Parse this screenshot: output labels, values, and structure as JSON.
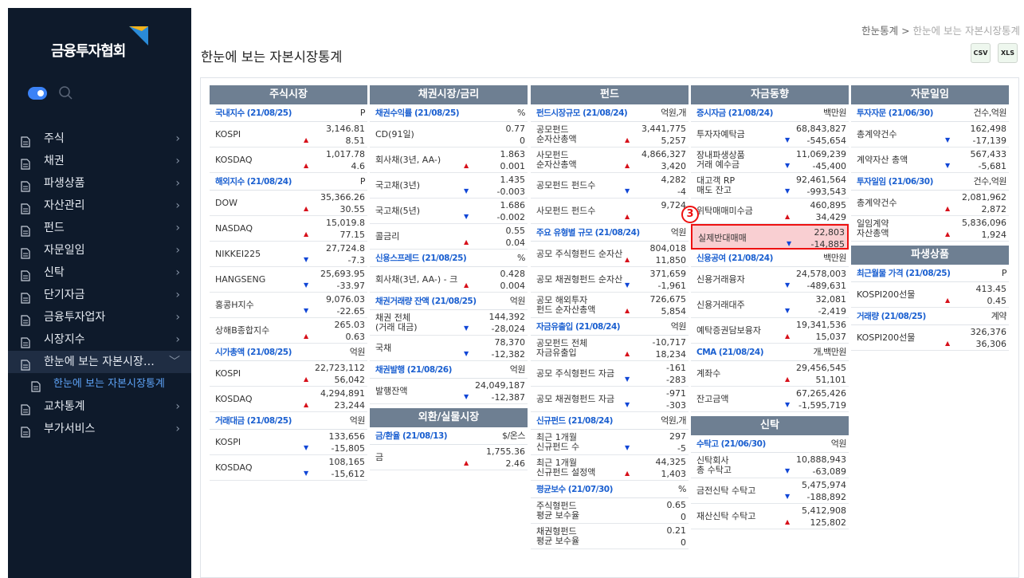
{
  "sidebar": {
    "logo": "금융투자협회",
    "items": [
      {
        "label": "주식"
      },
      {
        "label": "채권"
      },
      {
        "label": "파생상품"
      },
      {
        "label": "자산관리"
      },
      {
        "label": "펀드"
      },
      {
        "label": "자문일임"
      },
      {
        "label": "신탁"
      },
      {
        "label": "단기자금"
      },
      {
        "label": "금융투자업자"
      },
      {
        "label": "시장지수"
      },
      {
        "label": "한눈에 보는 자본시장…"
      },
      {
        "label": "한눈에 보는 자본시장통계"
      },
      {
        "label": "교차통계"
      },
      {
        "label": "부가서비스"
      }
    ]
  },
  "header": {
    "breadcrumb_home": "한눈통계",
    "breadcrumb_sep": ">",
    "breadcrumb_current": "한눈에 보는 자본시장통계",
    "title": "한눈에 보는 자본시장통계",
    "dl1": "CSV",
    "dl2": "XLS"
  },
  "badge": "3",
  "columns": [
    {
      "blocks": [
        {
          "header": "주식시장",
          "sections": [
            {
              "title": "국내지수 (21/08/25)",
              "unit": "P",
              "rows": [
                {
                  "name": "KOSPI",
                  "v1": "3,146.81",
                  "v2": "8.51",
                  "dir": "up"
                },
                {
                  "name": "KOSDAQ",
                  "v1": "1,017.78",
                  "v2": "4.6",
                  "dir": "up"
                }
              ]
            },
            {
              "title": "해외지수 (21/08/24)",
              "unit": "P",
              "rows": [
                {
                  "name": "DOW",
                  "v1": "35,366.26",
                  "v2": "30.55",
                  "dir": "up"
                },
                {
                  "name": "NASDAQ",
                  "v1": "15,019.8",
                  "v2": "77.15",
                  "dir": "up"
                },
                {
                  "name": "NIKKEI225",
                  "v1": "27,724.8",
                  "v2": "-7.3",
                  "dir": "dn"
                },
                {
                  "name": "HANGSENG",
                  "v1": "25,693.95",
                  "v2": "-33.97",
                  "dir": "dn"
                },
                {
                  "name": "홍콩H지수",
                  "v1": "9,076.03",
                  "v2": "-22.65",
                  "dir": "dn"
                },
                {
                  "name": "상해B종합지수",
                  "v1": "265.03",
                  "v2": "0.63",
                  "dir": "up"
                }
              ]
            },
            {
              "title": "시가총액 (21/08/25)",
              "unit": "억원",
              "rows": [
                {
                  "name": "KOSPI",
                  "v1": "22,723,112",
                  "v2": "56,042",
                  "dir": "up"
                },
                {
                  "name": "KOSDAQ",
                  "v1": "4,294,891",
                  "v2": "23,244",
                  "dir": "up"
                }
              ]
            },
            {
              "title": "거래대금 (21/08/25)",
              "unit": "억원",
              "rows": [
                {
                  "name": "KOSPI",
                  "v1": "133,656",
                  "v2": "-15,805",
                  "dir": "dn"
                },
                {
                  "name": "KOSDAQ",
                  "v1": "108,165",
                  "v2": "-15,612",
                  "dir": "dn"
                }
              ]
            }
          ]
        }
      ]
    },
    {
      "blocks": [
        {
          "header": "채권시장/금리",
          "sections": [
            {
              "title": "채권수익률 (21/08/25)",
              "unit": "%",
              "rows": [
                {
                  "name": "CD(91일)",
                  "v1": "0.77",
                  "v2": "0",
                  "dir": ""
                },
                {
                  "name": "회사채(3년, AA-)",
                  "v1": "1.863",
                  "v2": "0.001",
                  "dir": "up"
                },
                {
                  "name": "국고채(3년)",
                  "v1": "1.435",
                  "v2": "-0.003",
                  "dir": "dn"
                },
                {
                  "name": "국고채(5년)",
                  "v1": "1.686",
                  "v2": "-0.002",
                  "dir": "dn"
                },
                {
                  "name": "콜금리",
                  "v1": "0.55",
                  "v2": "0.04",
                  "dir": "up"
                }
              ]
            },
            {
              "title": "신용스프레드 (21/08/25)",
              "unit": "%",
              "rows": [
                {
                  "name": "회사채(3년, AA-) - 크",
                  "v1": "0.428",
                  "v2": "0.004",
                  "dir": "up"
                }
              ]
            },
            {
              "title": "채권거래량 잔액 (21/08/25)",
              "unit": "억원",
              "rows": [
                {
                  "name": "채권 전체\n(거래 대금)",
                  "v1": "144,392",
                  "v2": "-28,024",
                  "dir": "dn"
                },
                {
                  "name": "국채",
                  "v1": "78,370",
                  "v2": "-12,382",
                  "dir": "dn"
                }
              ]
            },
            {
              "title": "채권발행 (21/08/26)",
              "unit": "억원",
              "rows": [
                {
                  "name": "발행잔액",
                  "v1": "24,049,187",
                  "v2": "-12,387",
                  "dir": "dn"
                }
              ]
            }
          ]
        },
        {
          "header": "외환/실물시장",
          "sections": [
            {
              "title": "금/환율 (21/08/13)",
              "unit": "$/온스",
              "rows": [
                {
                  "name": "금",
                  "v1": "1,755.36",
                  "v2": "2.46",
                  "dir": "up"
                }
              ]
            }
          ]
        }
      ]
    },
    {
      "blocks": [
        {
          "header": "펀드",
          "sections": [
            {
              "title": "펀드시장규모 (21/08/24)",
              "unit": "억원,개",
              "rows": [
                {
                  "name": "공모펀드\n순자산총액",
                  "v1": "3,441,775",
                  "v2": "5,257",
                  "dir": "up"
                },
                {
                  "name": "사모펀드\n순자산총액",
                  "v1": "4,866,327",
                  "v2": "3,420",
                  "dir": "up"
                },
                {
                  "name": "공모펀드 펀드수",
                  "v1": "4,282",
                  "v2": "-4",
                  "dir": "dn"
                },
                {
                  "name": "사모펀드 펀드수",
                  "v1": "9,724",
                  "v2": "",
                  "dir": "up"
                }
              ]
            },
            {
              "title": "주요 유형별 규모 (21/08/24)",
              "unit": "억원",
              "rows": [
                {
                  "name": "공모 주식형펀드 순자산",
                  "v1": "804,018",
                  "v2": "11,850",
                  "dir": "up"
                },
                {
                  "name": "공모 채권형펀드 순자산",
                  "v1": "371,659",
                  "v2": "-1,961",
                  "dir": "dn"
                },
                {
                  "name": "공모 해외투자\n펀드 순자산총액",
                  "v1": "726,675",
                  "v2": "5,854",
                  "dir": "up"
                }
              ]
            },
            {
              "title": "자금유출입 (21/08/24)",
              "unit": "억원",
              "rows": [
                {
                  "name": "공모펀드 전체\n자금유출입",
                  "v1": "-10,717",
                  "v2": "18,234",
                  "dir": "up"
                },
                {
                  "name": "공모 주식형펀드 자금",
                  "v1": "-161",
                  "v2": "-283",
                  "dir": "dn"
                },
                {
                  "name": "공모 채권형펀드 자금",
                  "v1": "-971",
                  "v2": "-303",
                  "dir": "dn"
                }
              ]
            },
            {
              "title": "신규펀드 (21/08/24)",
              "unit": "억원,개",
              "rows": [
                {
                  "name": "최근 1개월\n신규펀드 수",
                  "v1": "297",
                  "v2": "-5",
                  "dir": "dn"
                },
                {
                  "name": "최근 1개월\n신규펀드 설정액",
                  "v1": "44,325",
                  "v2": "1,403",
                  "dir": "up"
                }
              ]
            },
            {
              "title": "평균보수 (21/07/30)",
              "unit": "%",
              "rows": [
                {
                  "name": "주식형펀드\n평균 보수율",
                  "v1": "0.65",
                  "v2": "0",
                  "dir": ""
                },
                {
                  "name": "채권형펀드\n평균 보수율",
                  "v1": "0.21",
                  "v2": "0",
                  "dir": ""
                }
              ]
            }
          ]
        }
      ]
    },
    {
      "blocks": [
        {
          "header": "자금동향",
          "sections": [
            {
              "title": "증시자금 (21/08/24)",
              "unit": "백만원",
              "rows": [
                {
                  "name": "투자자예탁금",
                  "v1": "68,843,827",
                  "v2": "-545,654",
                  "dir": "dn"
                },
                {
                  "name": "장내파생상품\n거래 예수금",
                  "v1": "11,069,239",
                  "v2": "-45,400",
                  "dir": "dn"
                },
                {
                  "name": "대고객 RP\n매도 잔고",
                  "v1": "92,461,564",
                  "v2": "-993,543",
                  "dir": "dn"
                },
                {
                  "name": "위탁매매미수금",
                  "v1": "460,895",
                  "v2": "34,429",
                  "dir": "up"
                },
                {
                  "name": "실제반대매매",
                  "v1": "22,803",
                  "v2": "-14,885",
                  "dir": "dn",
                  "hl": true
                }
              ]
            },
            {
              "title": "신용공여 (21/08/24)",
              "unit": "백만원",
              "rows": [
                {
                  "name": "신용거래융자",
                  "v1": "24,578,003",
                  "v2": "-489,631",
                  "dir": "dn"
                },
                {
                  "name": "신용거래대주",
                  "v1": "32,081",
                  "v2": "-2,419",
                  "dir": "dn"
                },
                {
                  "name": "예탁증권담보융자",
                  "v1": "19,341,536",
                  "v2": "15,037",
                  "dir": "up"
                }
              ]
            },
            {
              "title": "CMA (21/08/24)",
              "unit": "개,백만원",
              "rows": [
                {
                  "name": "계좌수",
                  "v1": "29,456,545",
                  "v2": "51,101",
                  "dir": "up"
                },
                {
                  "name": "잔고금액",
                  "v1": "67,265,426",
                  "v2": "-1,595,719",
                  "dir": "dn"
                }
              ]
            }
          ]
        },
        {
          "header": "신탁",
          "sections": [
            {
              "title": "수탁고 (21/06/30)",
              "unit": "억원",
              "rows": [
                {
                  "name": "신탁회사\n총 수탁고",
                  "v1": "10,888,943",
                  "v2": "-63,089",
                  "dir": "dn"
                },
                {
                  "name": "금전신탁 수탁고",
                  "v1": "5,475,974",
                  "v2": "-188,892",
                  "dir": "dn"
                },
                {
                  "name": "재산신탁 수탁고",
                  "v1": "5,412,908",
                  "v2": "125,802",
                  "dir": "up"
                }
              ]
            }
          ]
        }
      ]
    },
    {
      "blocks": [
        {
          "header": "자문일임",
          "sections": [
            {
              "title": "투자자문 (21/06/30)",
              "unit": "건수,억원",
              "rows": [
                {
                  "name": "총계약건수",
                  "v1": "162,498",
                  "v2": "-17,139",
                  "dir": "dn"
                },
                {
                  "name": "계약자산 총액",
                  "v1": "567,433",
                  "v2": "-5,681",
                  "dir": "dn"
                }
              ]
            },
            {
              "title": "투자일임 (21/06/30)",
              "unit": "건수,억원",
              "rows": [
                {
                  "name": "총계약건수",
                  "v1": "2,081,962",
                  "v2": "2,872",
                  "dir": "up"
                },
                {
                  "name": "일임계약\n자산총액",
                  "v1": "5,836,096",
                  "v2": "1,924",
                  "dir": "up"
                }
              ]
            }
          ]
        },
        {
          "header": "파생상품",
          "sections": [
            {
              "title": "최근월물 가격 (21/08/25)",
              "unit": "P",
              "rows": [
                {
                  "name": "KOSPI200선물",
                  "v1": "413.45",
                  "v2": "0.45",
                  "dir": "up"
                }
              ]
            },
            {
              "title": "거래량 (21/08/25)",
              "unit": "계약",
              "rows": [
                {
                  "name": "KOSPI200선물",
                  "v1": "326,376",
                  "v2": "36,306",
                  "dir": "up"
                }
              ]
            }
          ]
        }
      ]
    }
  ]
}
